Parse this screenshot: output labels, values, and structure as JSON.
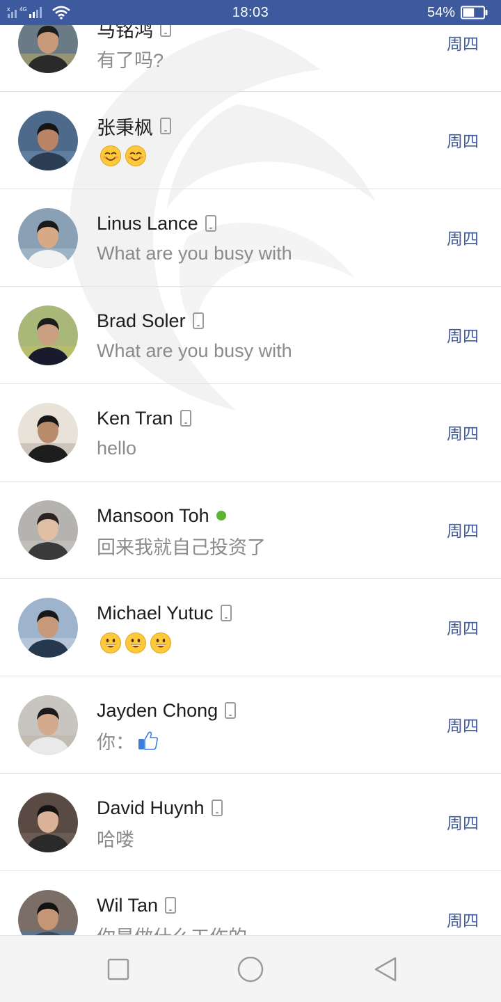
{
  "status_bar": {
    "time": "18:03",
    "battery_percent": "54%",
    "battery_level": 0.54,
    "network_label": "4G"
  },
  "colors": {
    "status_bar_bg": "#3d5a9e",
    "day_text": "#3d5a9e",
    "online_dot": "#5bb531"
  },
  "conversations": [
    {
      "name": "马铭鸿",
      "message": "有了吗?",
      "day": "周四",
      "presence": "mobile"
    },
    {
      "name": "张秉枫",
      "message": "",
      "emoji": [
        "smiling-blush",
        "smiling-blush"
      ],
      "day": "周四",
      "presence": "mobile"
    },
    {
      "name": "Linus Lance",
      "message": "What are you busy with",
      "day": "周四",
      "presence": "mobile"
    },
    {
      "name": "Brad Soler",
      "message": "What are you busy with",
      "day": "周四",
      "presence": "mobile"
    },
    {
      "name": "Ken Tran",
      "message": "hello",
      "day": "周四",
      "presence": "mobile"
    },
    {
      "name": "Mansoon Toh",
      "message": "回来我就自己投资了",
      "day": "周四",
      "presence": "online"
    },
    {
      "name": "Michael Yutuc",
      "message": "",
      "emoji": [
        "grinning",
        "grinning",
        "grinning"
      ],
      "day": "周四",
      "presence": "mobile"
    },
    {
      "name": "Jayden Chong",
      "message": "你：",
      "emoji": [
        "thumbs-up"
      ],
      "day": "周四",
      "presence": "mobile"
    },
    {
      "name": "David Huynh",
      "message": "哈喽",
      "day": "周四",
      "presence": "mobile"
    },
    {
      "name": "Wil Tan",
      "message": "你是做什么工作的",
      "day": "周四",
      "presence": "mobile"
    }
  ],
  "nav_bar": {
    "icons": [
      "square-icon",
      "circle-home-icon",
      "triangle-back-icon"
    ]
  }
}
